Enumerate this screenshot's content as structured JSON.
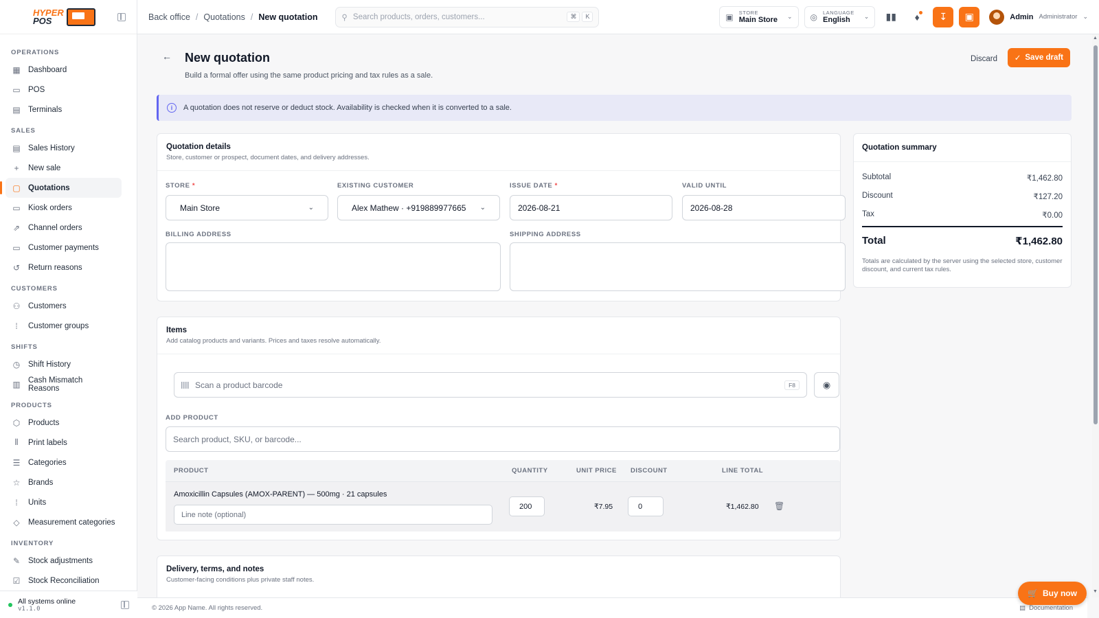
{
  "brand": {
    "line1": "HYPER",
    "line2": "POS"
  },
  "sidebar": {
    "sections": [
      {
        "title": "OPERATIONS",
        "items": [
          {
            "label": "Dashboard",
            "icon": "grid-icon"
          },
          {
            "label": "POS",
            "icon": "monitor-icon"
          },
          {
            "label": "Terminals",
            "icon": "terminal-icon"
          }
        ]
      },
      {
        "title": "SALES",
        "items": [
          {
            "label": "Sales History",
            "icon": "receipt-icon"
          },
          {
            "label": "New sale",
            "icon": "plus-icon"
          },
          {
            "label": "Quotations",
            "icon": "note-icon",
            "active": true
          },
          {
            "label": "Kiosk orders",
            "icon": "kiosk-icon"
          },
          {
            "label": "Channel orders",
            "icon": "external-link-icon"
          },
          {
            "label": "Customer payments",
            "icon": "cash-icon"
          },
          {
            "label": "Return reasons",
            "icon": "undo-icon"
          }
        ]
      },
      {
        "title": "CUSTOMERS",
        "items": [
          {
            "label": "Customers",
            "icon": "users-icon"
          },
          {
            "label": "Customer groups",
            "icon": "dots-grid-icon"
          }
        ]
      },
      {
        "title": "SHIFTS",
        "items": [
          {
            "label": "Shift History",
            "icon": "clock-icon"
          },
          {
            "label": "Cash Mismatch Reasons",
            "icon": "bar-chart-icon"
          }
        ]
      },
      {
        "title": "PRODUCTS",
        "items": [
          {
            "label": "Products",
            "icon": "box-icon"
          },
          {
            "label": "Print labels",
            "icon": "barcode-icon"
          },
          {
            "label": "Categories",
            "icon": "list-icon"
          },
          {
            "label": "Brands",
            "icon": "star-icon"
          },
          {
            "label": "Units",
            "icon": "dots-grid-icon"
          },
          {
            "label": "Measurement categories",
            "icon": "tag-icon"
          }
        ]
      },
      {
        "title": "INVENTORY",
        "items": [
          {
            "label": "Stock adjustments",
            "icon": "edit-icon"
          },
          {
            "label": "Stock Reconciliation",
            "icon": "check-list-icon"
          }
        ]
      }
    ],
    "status": "All systems online",
    "version": "v1.1.0"
  },
  "topbar": {
    "breadcrumb": [
      "Back office",
      "Quotations",
      "New quotation"
    ],
    "search_placeholder": "Search products, orders, customers...",
    "kbd": [
      "⌘",
      "K"
    ],
    "store_label": "STORE",
    "store_value": "Main Store",
    "language_label": "LANGUAGE",
    "language_value": "English",
    "user_name": "Admin",
    "user_role": "Administrator"
  },
  "page": {
    "title": "New quotation",
    "subtitle": "Build a formal offer using the same product pricing and tax rules as a sale.",
    "discard": "Discard",
    "save": "Save draft",
    "info": "A quotation does not reserve or deduct stock. Availability is checked when it is converted to a sale."
  },
  "details": {
    "title": "Quotation details",
    "desc": "Store, customer or prospect, document dates, and delivery addresses.",
    "store_label": "STORE",
    "store_value": "Main Store",
    "customer_label": "EXISTING CUSTOMER",
    "customer_value": "Alex Mathew · +919889977665",
    "issue_label": "ISSUE DATE",
    "issue_value": "2026-08-21",
    "valid_label": "VALID UNTIL",
    "valid_value": "2026-08-28",
    "billing_label": "BILLING ADDRESS",
    "shipping_label": "SHIPPING ADDRESS"
  },
  "items": {
    "title": "Items",
    "desc": "Add catalog products and variants. Prices and taxes resolve automatically.",
    "barcode_placeholder": "Scan a product barcode",
    "barcode_key": "F8",
    "add_label": "ADD PRODUCT",
    "add_placeholder": "Search product, SKU, or barcode...",
    "columns": [
      "PRODUCT",
      "QUANTITY",
      "UNIT PRICE",
      "DISCOUNT",
      "LINE TOTAL"
    ],
    "rows": [
      {
        "product": "Amoxicillin Capsules (AMOX-PARENT) — 500mg · 21 capsules",
        "note_placeholder": "Line note (optional)",
        "quantity": "200",
        "unit_price": "₹7.95",
        "discount": "0",
        "line_total": "₹1,462.80"
      }
    ]
  },
  "delivery": {
    "title": "Delivery, terms, and notes",
    "desc": "Customer-facing conditions plus private staff notes."
  },
  "summary": {
    "title": "Quotation summary",
    "subtotal_label": "Subtotal",
    "subtotal": "₹1,462.80",
    "discount_label": "Discount",
    "discount": "₹127.20",
    "tax_label": "Tax",
    "tax": "₹0.00",
    "total_label": "Total",
    "total": "₹1,462.80",
    "note": "Totals are calculated by the server using the selected store, customer discount, and current tax rules."
  },
  "footer": {
    "copyright": "© 2026 App Name. All rights reserved.",
    "docs": "Documentation"
  },
  "buy_now": "Buy now",
  "colors": {
    "accent": "#f97316",
    "info": "#6366f1"
  }
}
